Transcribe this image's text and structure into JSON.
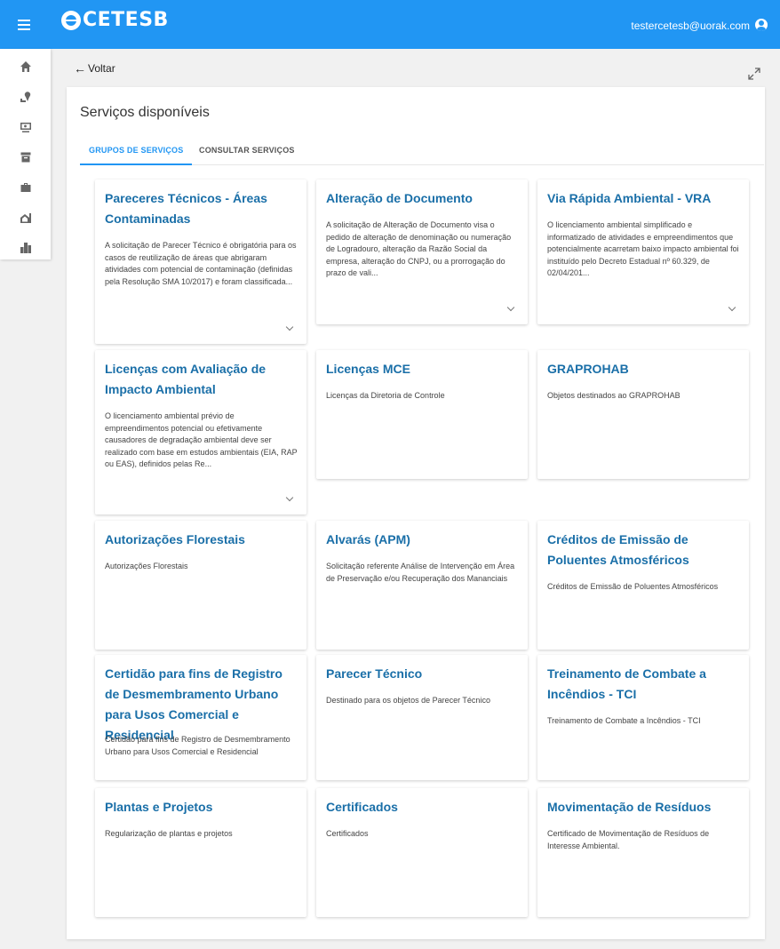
{
  "header": {
    "logo_text": "CETESB",
    "user_email": "testercetesb@uorak.com"
  },
  "sidebar": {
    "items": [
      {
        "icon": "home-icon"
      },
      {
        "icon": "person-location-icon"
      },
      {
        "icon": "monitor-search-icon"
      },
      {
        "icon": "archive-icon"
      },
      {
        "icon": "briefcase-icon"
      },
      {
        "icon": "building-outline-icon"
      },
      {
        "icon": "city-icon"
      }
    ]
  },
  "nav": {
    "back_label": "Voltar"
  },
  "page": {
    "title": "Serviços disponíveis",
    "tabs": [
      {
        "label": "GRUPOS DE SERVIÇOS",
        "active": true
      },
      {
        "label": "CONSULTAR SERVIÇOS",
        "active": false
      }
    ]
  },
  "cards": [
    {
      "title": "Pareceres Técnicos - Áreas Contaminadas",
      "desc": "A solicitação de Parecer Técnico é obrigatória para os casos de reutilização de áreas que abrigaram atividades com potencial de contaminação (definidas pela Resolução SMA 10/2017) e foram classificada...",
      "expandable": true
    },
    {
      "title": "Alteração de Documento",
      "desc": "A solicitação de Alteração de Documento visa o pedido de alteração de denominação ou numeração de Logradouro, alteração da Razão Social da empresa, alteração do CNPJ, ou a prorrogação do prazo de vali...",
      "expandable": true
    },
    {
      "title": "Via Rápida Ambiental - VRA",
      "desc": "O licenciamento ambiental simplificado e informatizado de atividades e empreendimentos que potencialmente acarretam baixo impacto ambiental foi instituído pelo Decreto Estadual nº 60.329, de 02/04/201...",
      "expandable": true
    },
    {
      "title": "Licenças com Avaliação de Impacto Ambiental",
      "desc": "O licenciamento ambiental prévio de empreendimentos potencial ou efetivamente causadores de degradação ambiental deve ser realizado com base em estudos ambientais (EIA, RAP ou EAS), definidos pelas Re...",
      "expandable": true
    },
    {
      "title": "Licenças MCE",
      "desc": "Licenças da Diretoria de Controle",
      "expandable": false
    },
    {
      "title": "GRAPROHAB",
      "desc": "Objetos destinados ao GRAPROHAB",
      "expandable": false
    },
    {
      "title": "Autorizações Florestais",
      "desc": "Autorizações Florestais",
      "expandable": false
    },
    {
      "title": "Alvarás (APM)",
      "desc": "Solicitação referente Análise de Intervenção em Área de Preservação e/ou Recuperação dos Mananciais",
      "expandable": false
    },
    {
      "title": "Créditos de Emissão de Poluentes Atmosféricos",
      "desc": "Créditos de Emissão de Poluentes Atmosféricos",
      "expandable": false
    },
    {
      "title": "Certidão para fins de Registro de Desmembramento Urbano para Usos Comercial e Residencial",
      "desc": "Certidão para fins de Registro de Desmembramento Urbano para Usos Comercial e Residencial",
      "expandable": false
    },
    {
      "title": "Parecer Técnico",
      "desc": "Destinado para os objetos de Parecer Técnico",
      "expandable": false
    },
    {
      "title": "Treinamento de Combate a Incêndios - TCI",
      "desc": "Treinamento de Combate a Incêndios - TCI",
      "expandable": false
    },
    {
      "title": "Plantas e Projetos",
      "desc": "Regularização de plantas e projetos",
      "expandable": false
    },
    {
      "title": "Certificados",
      "desc": "Certificados",
      "expandable": false
    },
    {
      "title": "Movimentação de Resíduos",
      "desc": "Certificado de Movimentação de Resíduos de Interesse Ambiental.",
      "expandable": false
    }
  ]
}
